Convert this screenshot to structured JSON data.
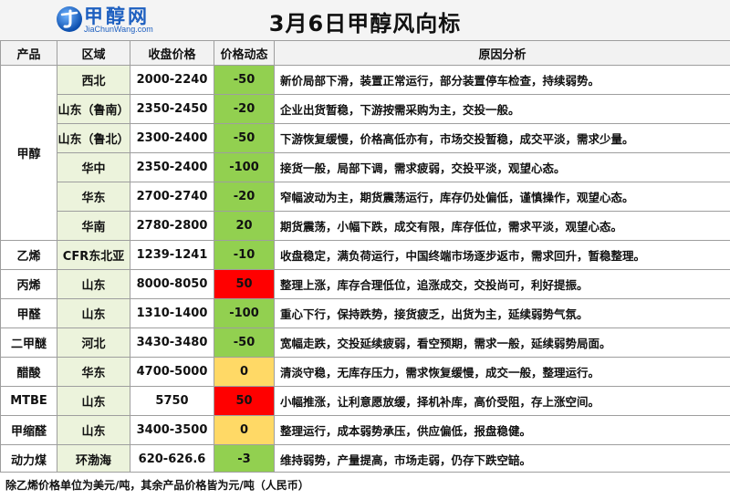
{
  "header": {
    "logo_cn": "甲醇网",
    "logo_en": "JiaChunWang.com",
    "title": "3月6日甲醇风向标"
  },
  "table": {
    "columns": [
      "产品",
      "区域",
      "收盘价格",
      "价格动态",
      "原因分析"
    ],
    "rows": [
      {
        "product": "甲醇",
        "region": "西北",
        "price": "2000-2240",
        "change": "-50",
        "change_color": "green",
        "reason": "新价局部下滑，装置正常运行，部分装置停车检查，持续弱势。"
      },
      {
        "product": "",
        "region": "山东（鲁南）",
        "price": "2350-2450",
        "change": "-20",
        "change_color": "green",
        "reason": "企业出货暂稳，下游按需采购为主，交投一般。"
      },
      {
        "product": "",
        "region": "山东（鲁北）",
        "price": "2300-2400",
        "change": "-50",
        "change_color": "green",
        "reason": "下游恢复缓慢，价格高低亦有，市场交投暂稳，成交平淡，需求少量。"
      },
      {
        "product": "",
        "region": "华中",
        "price": "2350-2400",
        "change": "-100",
        "change_color": "green",
        "reason": "接货一般，局部下调，需求疲弱，交投平淡，观望心态。"
      },
      {
        "product": "",
        "region": "华东",
        "price": "2700-2740",
        "change": "-20",
        "change_color": "green",
        "reason": "窄幅波动为主，期货震荡运行，库存仍处偏低，谨慎操作，观望心态。"
      },
      {
        "product": "",
        "region": "华南",
        "price": "2780-2800",
        "change": "20",
        "change_color": "green",
        "reason": "期货震荡，小幅下跌，成交有限，库存低位，需求平淡，观望心态。"
      },
      {
        "product": "乙烯",
        "region": "CFR东北亚",
        "price": "1239-1241",
        "change": "-10",
        "change_color": "green",
        "reason": "收盘稳定，满负荷运行，中国终端市场逐步返市，需求回升，暂稳整理。"
      },
      {
        "product": "丙烯",
        "region": "山东",
        "price": "8000-8050",
        "change": "50",
        "change_color": "red",
        "reason": "整理上涨，库存合理低位，追涨成交，交投尚可，利好提振。"
      },
      {
        "product": "甲醛",
        "region": "山东",
        "price": "1310-1400",
        "change": "-100",
        "change_color": "green",
        "reason": "重心下行，保持跌势，接货疲乏，出货为主，延续弱势气氛。"
      },
      {
        "product": "二甲醚",
        "region": "河北",
        "price": "3430-3480",
        "change": "-50",
        "change_color": "green",
        "reason": "宽幅走跌，交投延续疲弱，看空预期，需求一般，延续弱势局面。"
      },
      {
        "product": "醋酸",
        "region": "华东",
        "price": "4700-5000",
        "change": "0",
        "change_color": "yellow",
        "reason": "清淡守稳，无库存压力，需求恢复缓慢，成交一般，整理运行。"
      },
      {
        "product": "MTBE",
        "region": "山东",
        "price": "5750",
        "change": "50",
        "change_color": "red",
        "reason": "小幅推涨，让利意愿放缓，择机补库，高价受阻，存上涨空间。"
      },
      {
        "product": "甲缩醛",
        "region": "山东",
        "price": "3400-3500",
        "change": "0",
        "change_color": "yellow",
        "reason": "整理运行，成本弱势承压，供应偏低，报盘稳健。"
      },
      {
        "product": "动力煤",
        "region": "环渤海",
        "price": "620-626.6",
        "change": "-3",
        "change_color": "green",
        "reason": "维持弱势，产量提高，市场走弱，仍存下跌空䍌。"
      }
    ]
  },
  "footer": {
    "note": "除乙烯价格单位为美元/吨，其余产品价格皆为元/吨（人民币）"
  },
  "colors": {
    "green": "#92d050",
    "red": "#ff0000",
    "yellow": "#ffd966",
    "region_bg": "#ecf3dc"
  }
}
